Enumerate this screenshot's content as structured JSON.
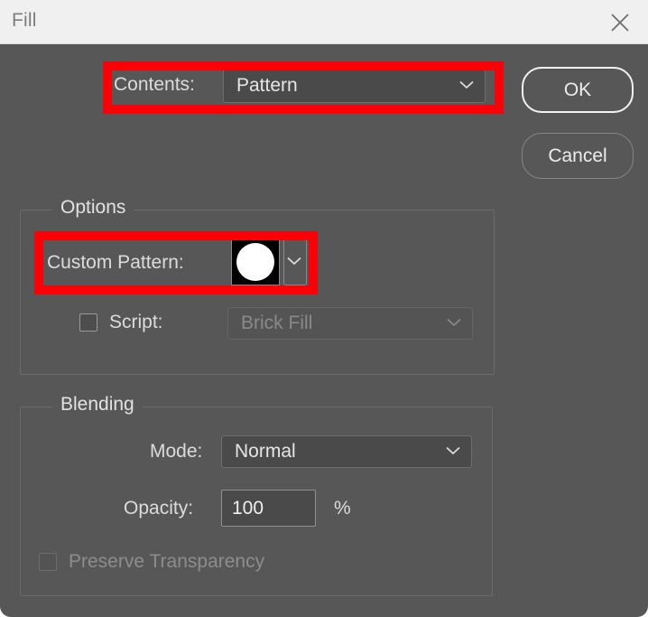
{
  "window": {
    "title": "Fill",
    "close_icon": "close-icon"
  },
  "contents_row": {
    "label": "Contents:",
    "value": "Pattern",
    "chevron_icon": "chevron-down-icon"
  },
  "buttons": {
    "ok": "OK",
    "cancel": "Cancel"
  },
  "options_group": {
    "title": "Options",
    "custom_pattern": {
      "label": "Custom Pattern:",
      "swatch_icon": "pattern-swatch-white-circle",
      "swatch_background": "#000000",
      "swatch_shape_color": "#ffffff",
      "chevron_icon": "chevron-down-icon"
    },
    "script": {
      "label": "Script:",
      "checked": false,
      "value": "Brick Fill",
      "enabled": false,
      "chevron_icon": "chevron-down-icon"
    }
  },
  "blending_group": {
    "title": "Blending",
    "mode": {
      "label": "Mode:",
      "value": "Normal",
      "chevron_icon": "chevron-down-icon"
    },
    "opacity": {
      "label": "Opacity:",
      "value": "100",
      "unit": "%"
    },
    "preserve_transparency": {
      "label": "Preserve Transparency",
      "checked": false,
      "enabled": false
    }
  },
  "annotations": {
    "highlight_color": "#fb0007",
    "boxes": [
      {
        "name": "contents-highlight"
      },
      {
        "name": "custom-pattern-highlight"
      }
    ]
  },
  "colors": {
    "dialog_background": "#575757",
    "titlebar_background": "#f0f0f0",
    "field_background": "#4a4a4a",
    "text": "#dcdcdc",
    "disabled_text": "#8a8a8a"
  }
}
